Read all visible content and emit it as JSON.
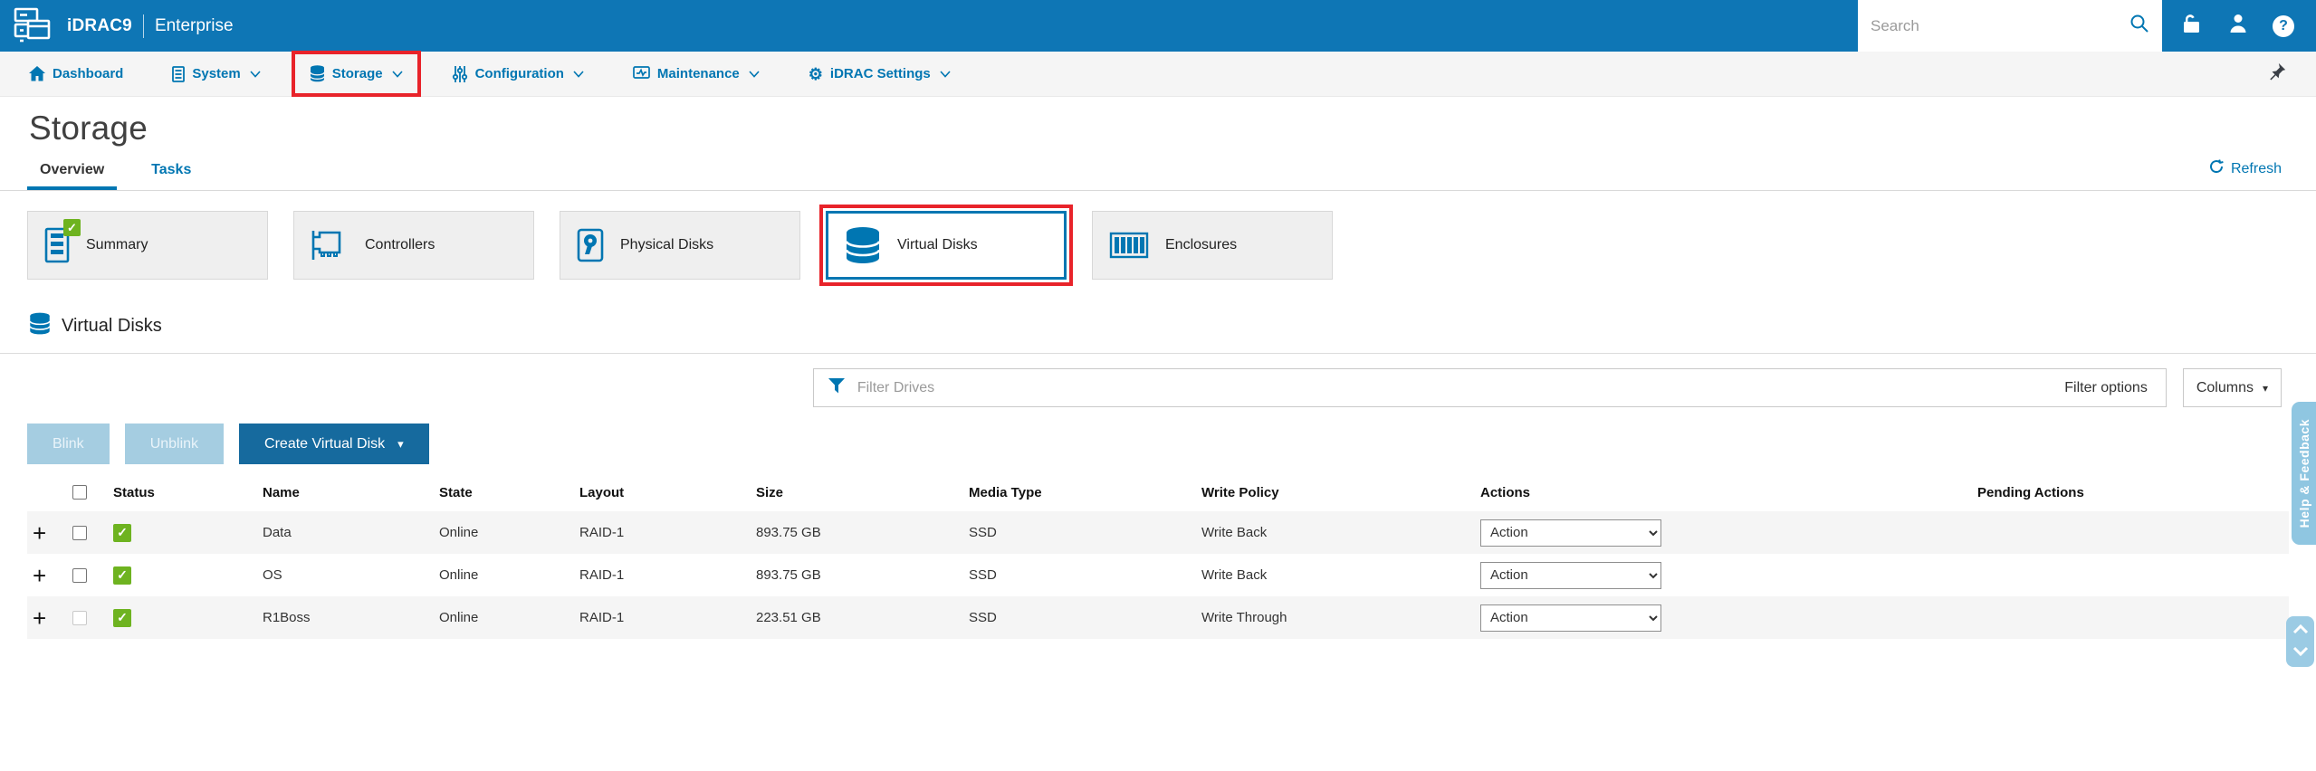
{
  "header": {
    "product": "iDRAC9",
    "edition": "Enterprise",
    "search_placeholder": "Search"
  },
  "nav": {
    "items": [
      {
        "label": "Dashboard"
      },
      {
        "label": "System"
      },
      {
        "label": "Storage",
        "annotated": true
      },
      {
        "label": "Configuration"
      },
      {
        "label": "Maintenance"
      },
      {
        "label": "iDRAC Settings"
      }
    ]
  },
  "page": {
    "title": "Storage",
    "tabs": [
      {
        "label": "Overview",
        "active": true
      },
      {
        "label": "Tasks",
        "active": false
      }
    ],
    "refresh_label": "Refresh"
  },
  "tiles": [
    {
      "label": "Summary",
      "badge": "check"
    },
    {
      "label": "Controllers"
    },
    {
      "label": "Physical Disks"
    },
    {
      "label": "Virtual Disks",
      "selected": true,
      "annotated": true
    },
    {
      "label": "Enclosures"
    }
  ],
  "section": {
    "title": "Virtual Disks"
  },
  "filter": {
    "placeholder": "Filter Drives",
    "options_label": "Filter options",
    "columns_label": "Columns"
  },
  "toolbar": {
    "blink_label": "Blink",
    "unblink_label": "Unblink",
    "create_label": "Create Virtual Disk"
  },
  "table": {
    "headers": [
      "Status",
      "Name",
      "State",
      "Layout",
      "Size",
      "Media Type",
      "Write Policy",
      "Actions",
      "Pending Actions"
    ],
    "rows": [
      {
        "status": "ok",
        "name": "Data",
        "state": "Online",
        "layout": "RAID-1",
        "size": "893.75 GB",
        "media": "SSD",
        "write_policy": "Write Back",
        "action": "Action",
        "pending": ""
      },
      {
        "status": "ok",
        "name": "OS",
        "state": "Online",
        "layout": "RAID-1",
        "size": "893.75 GB",
        "media": "SSD",
        "write_policy": "Write Back",
        "action": "Action",
        "pending": ""
      },
      {
        "status": "ok",
        "name": "R1Boss",
        "state": "Online",
        "layout": "RAID-1",
        "size": "223.51 GB",
        "media": "SSD",
        "write_policy": "Write Through",
        "action": "Action",
        "pending": ""
      }
    ]
  },
  "side": {
    "help_label": "Help & Feedback"
  },
  "icons": {
    "check_glyph": "✓",
    "gear_glyph": "⚙",
    "caret_glyph": "▾"
  },
  "colors": {
    "header_blue": "#0e76b5",
    "accent_blue": "#0076b2",
    "success_green": "#6eb320",
    "annotation_red": "#e8232a",
    "disabled_button": "#a5cde1",
    "primary_button": "#166a9e"
  }
}
